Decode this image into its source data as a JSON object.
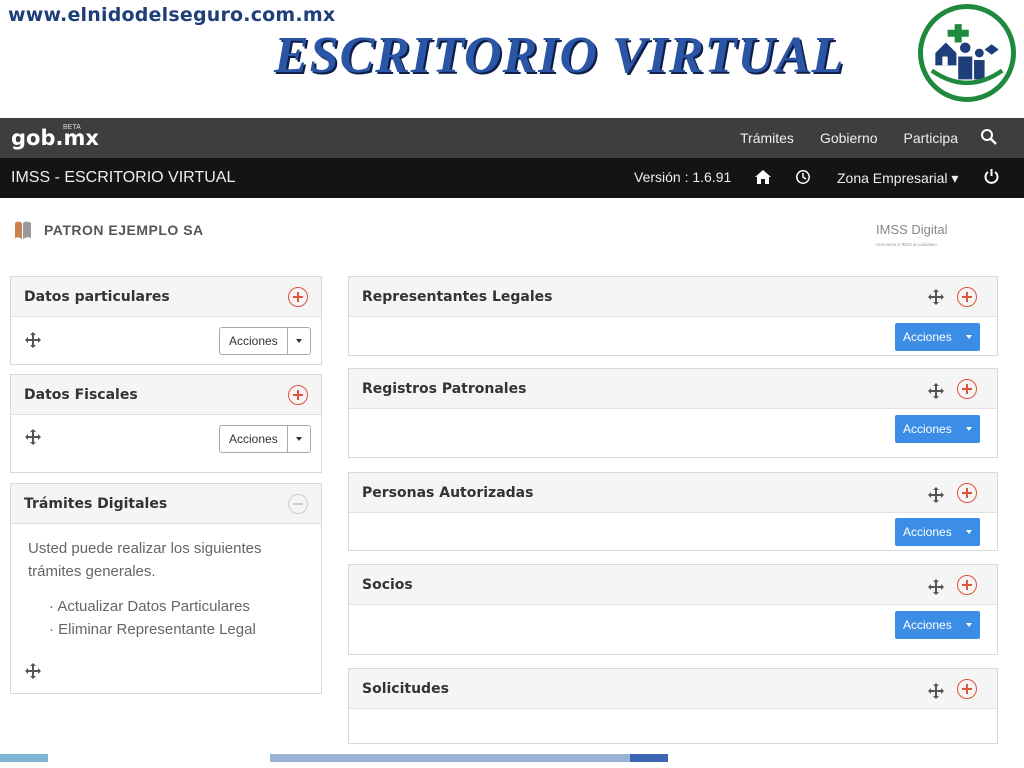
{
  "slide": {
    "url": "www.elnidodelseguro.com.mx",
    "title": "ESCRITORIO VIRTUAL"
  },
  "gob_bar": {
    "logo": "gob.mx",
    "beta": "BETA",
    "nav": [
      "Trámites",
      "Gobierno",
      "Participa"
    ]
  },
  "imss_bar": {
    "title": "IMSS - ESCRITORIO VIRTUAL",
    "version": "Versión : 1.6.91",
    "zona": "Zona Empresarial ▾"
  },
  "patron": {
    "name": "PATRON EJEMPLO SA"
  },
  "imss_digital": {
    "text": "IMSS Digital",
    "tagline": "Acercando el IMSS al ciudadano"
  },
  "left_panels": {
    "datos_particulares": {
      "title": "Datos particulares",
      "action": "Acciones"
    },
    "datos_fiscales": {
      "title": "Datos Fiscales",
      "action": "Acciones"
    },
    "tramites": {
      "title": "Trámites Digitales",
      "intro_line1": "Usted puede realizar los siguientes",
      "intro_line2": "trámites generales.",
      "items": [
        "Actualizar Datos Particulares",
        "Eliminar Representante Legal"
      ]
    }
  },
  "right_panels": [
    {
      "title": "Representantes Legales",
      "action": "Acciones"
    },
    {
      "title": "Registros Patronales",
      "action": "Acciones"
    },
    {
      "title": "Personas Autorizadas",
      "action": "Acciones"
    },
    {
      "title": "Socios",
      "action": "Acciones"
    },
    {
      "title": "Solicitudes"
    }
  ],
  "colors": {
    "accent_red": "#e0533d",
    "button_blue": "#3c8de6",
    "title_blue": "#2b55a5"
  }
}
